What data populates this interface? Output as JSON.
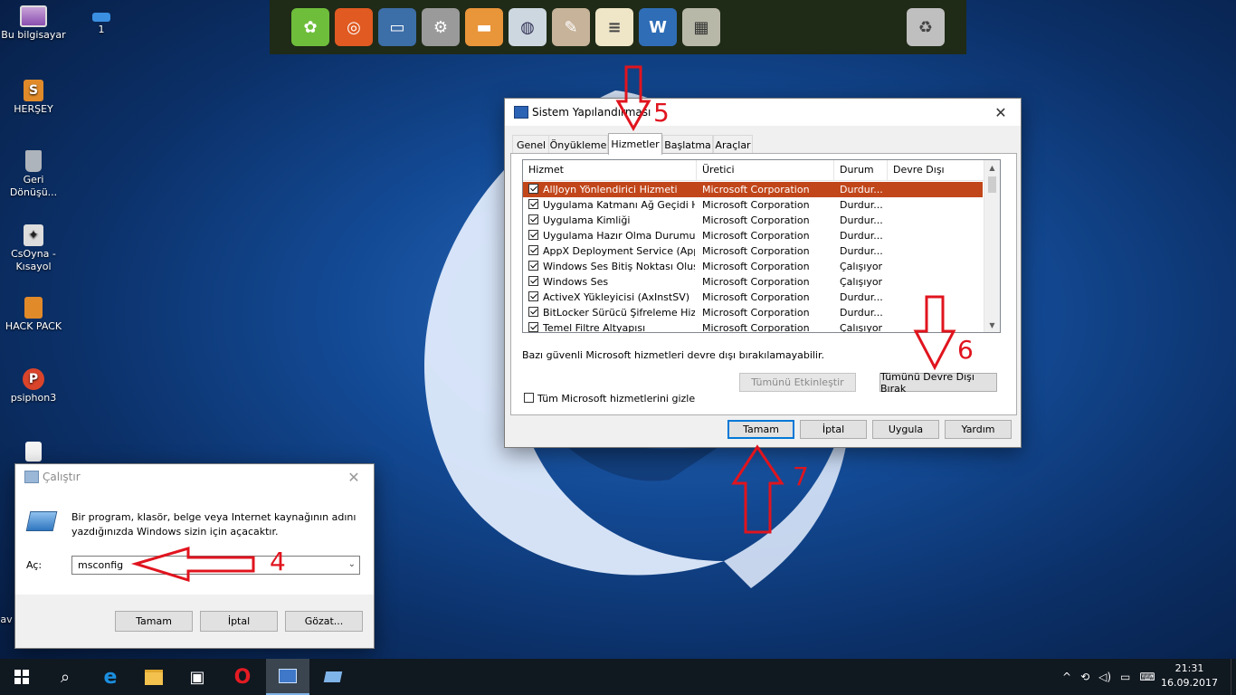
{
  "desktop": {
    "icons": [
      {
        "label": "Bu bilgisayar"
      },
      {
        "label": "1"
      },
      {
        "label": "HERŞEY"
      },
      {
        "label": "Geri Dönüşü..."
      },
      {
        "label": "CsOyna - Kısayol"
      },
      {
        "label": "HACK PACK"
      },
      {
        "label": "psiphon3"
      },
      {
        "label": "av"
      }
    ]
  },
  "dock": {
    "items": [
      "settings-gear",
      "ubuntu",
      "screen",
      "system-gear",
      "folder",
      "browser",
      "paint",
      "notepad",
      "writer",
      "calculator",
      "trash"
    ]
  },
  "msconfig": {
    "title": "Sistem Yapılandırması",
    "tabs": [
      "Genel",
      "Önyükleme",
      "Hizmetler",
      "Başlatma",
      "Araçlar"
    ],
    "active_tab": "Hizmetler",
    "columns": [
      "Hizmet",
      "Üretici",
      "Durum",
      "Devre Dışı Bırakı..."
    ],
    "rows": [
      {
        "service": "AllJoyn Yönlendirici Hizmeti",
        "vendor": "Microsoft Corporation",
        "status": "Durdur...",
        "checked": true
      },
      {
        "service": "Uygulama Katmanı Ağ Geçidi Hiz...",
        "vendor": "Microsoft Corporation",
        "status": "Durdur...",
        "checked": true
      },
      {
        "service": "Uygulama Kimliği",
        "vendor": "Microsoft Corporation",
        "status": "Durdur...",
        "checked": true
      },
      {
        "service": "Uygulama Hazır Olma Durumu",
        "vendor": "Microsoft Corporation",
        "status": "Durdur...",
        "checked": true
      },
      {
        "service": "AppX Deployment Service (AppX...",
        "vendor": "Microsoft Corporation",
        "status": "Durdur...",
        "checked": true
      },
      {
        "service": "Windows Ses Bitiş Noktası Oluşt...",
        "vendor": "Microsoft Corporation",
        "status": "Çalışıyor",
        "checked": true
      },
      {
        "service": "Windows Ses",
        "vendor": "Microsoft Corporation",
        "status": "Çalışıyor",
        "checked": true
      },
      {
        "service": "ActiveX Yükleyicisi (AxInstSV)",
        "vendor": "Microsoft Corporation",
        "status": "Durdur...",
        "checked": true
      },
      {
        "service": "BitLocker Sürücü Şifreleme Hizmeti",
        "vendor": "Microsoft Corporation",
        "status": "Durdur...",
        "checked": true
      },
      {
        "service": "Temel Filtre Altyapısı",
        "vendor": "Microsoft Corporation",
        "status": "Çalışıyor",
        "checked": true
      }
    ],
    "note": "Bazı güvenli Microsoft hizmetleri devre dışı bırakılamayabilir.",
    "enable_all": "Tümünü Etkinleştir",
    "disable_all": "Tümünü Devre Dışı Bırak",
    "hide_ms": "Tüm Microsoft hizmetlerini gizle",
    "ok": "Tamam",
    "cancel": "İptal",
    "apply": "Uygula",
    "help": "Yardım"
  },
  "run": {
    "title": "Çalıştır",
    "description": "Bir program, klasör, belge veya Internet kaynağının adını yazdığınızda Windows sizin için açacaktır.",
    "open_label": "Aç:",
    "value": "msconfig",
    "ok": "Tamam",
    "cancel": "İptal",
    "browse": "Gözat..."
  },
  "annotations": {
    "n4": "4",
    "n5": "5",
    "n6": "6",
    "n7": "7"
  },
  "taskbar": {
    "time": "21:31",
    "date": "16.09.2017"
  }
}
